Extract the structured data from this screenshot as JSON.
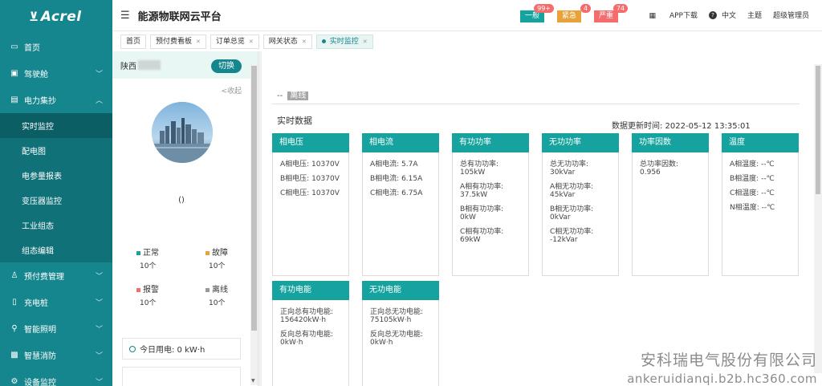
{
  "sidebar": {
    "logo": "Acrel",
    "items": [
      {
        "label": "首页",
        "icon": "monitor-icon"
      },
      {
        "label": "驾驶舱",
        "icon": "dashboard-icon"
      },
      {
        "label": "电力集抄",
        "icon": "meter-icon"
      }
    ],
    "sub_items": [
      "实时监控",
      "配电图",
      "电参量报表",
      "变压器监控",
      "工业组态",
      "组态编辑"
    ],
    "items_after": [
      {
        "label": "预付费管理",
        "icon": "user-icon"
      },
      {
        "label": "充电桩",
        "icon": "charger-icon"
      },
      {
        "label": "智能照明",
        "icon": "location-icon"
      },
      {
        "label": "智慧消防",
        "icon": "fire-icon"
      },
      {
        "label": "设备监控",
        "icon": "device-icon"
      }
    ]
  },
  "header": {
    "title": "能源物联网云平台",
    "alerts": [
      {
        "label": "一般",
        "count": "99+",
        "color": "#16a39f"
      },
      {
        "label": "紧急",
        "count": "4",
        "color": "#e9a23b"
      },
      {
        "label": "严重",
        "count": "74",
        "color": "#f56c6c"
      }
    ],
    "app_download": "APP下载",
    "language": "中文",
    "theme": "主题",
    "user": "超级管理员"
  },
  "tabs": [
    {
      "label": "首页",
      "closable": false
    },
    {
      "label": "预付费看板",
      "closable": true
    },
    {
      "label": "订单总览",
      "closable": true
    },
    {
      "label": "网关状态",
      "closable": true
    },
    {
      "label": "实时监控",
      "closable": true,
      "active": true
    }
  ],
  "left_panel": {
    "site_prefix": "陕西",
    "switch_label": "切换",
    "collapse_label": "<收起",
    "site_name": "()",
    "status": [
      {
        "label": "正常",
        "count": "10个",
        "color": "#16a39f"
      },
      {
        "label": "故障",
        "count": "10个",
        "color": "#e9a23b"
      },
      {
        "label": "报警",
        "count": "10个",
        "color": "#f56c6c"
      },
      {
        "label": "离线",
        "count": "10个",
        "color": "#999999"
      }
    ],
    "today_power_label": "今日用电: 0 kW·h"
  },
  "main": {
    "offline_prefix": "--",
    "offline_label": "离线",
    "realtime_title": "实时数据",
    "update_time": "数据更新时间: 2022-05-12 13:35:01",
    "cards": [
      {
        "title": "相电压",
        "lines": [
          "A相电压: 10370V",
          "B相电压: 10370V",
          "C相电压: 10370V"
        ]
      },
      {
        "title": "相电流",
        "lines": [
          "A相电流: 5.7A",
          "B相电流: 6.15A",
          "C相电流: 6.75A"
        ]
      },
      {
        "title": "有功功率",
        "lines": [
          "总有功功率: 105kW",
          "A相有功功率: 37.5kW",
          "B相有功功率: 0kW",
          "C相有功功率: 69kW"
        ]
      },
      {
        "title": "无功功率",
        "lines": [
          "总无功功率: 30kVar",
          "A相无功功率: 45kVar",
          "B相无功功率: 0kVar",
          "C相无功功率: -12kVar"
        ]
      },
      {
        "title": "功率因数",
        "lines": [
          "总功率因数: 0.956"
        ]
      },
      {
        "title": "温度",
        "lines": [
          "A相温度: --℃",
          "B相温度: --℃",
          "C相温度: --℃",
          "N相温度: --℃"
        ]
      },
      {
        "title": "有功电能",
        "lines": [
          "正向总有功电能: 156420kW·h",
          "反向总有功电能: 0kW·h"
        ]
      },
      {
        "title": "无功电能",
        "lines": [
          "正向总无功电能: 75105kW·h",
          "反向总无功电能: 0kW·h"
        ]
      }
    ]
  },
  "watermark": {
    "line1": "安科瑞电气股份有限公司",
    "line2": "ankeruidianqi.b2b.hc360.com"
  }
}
